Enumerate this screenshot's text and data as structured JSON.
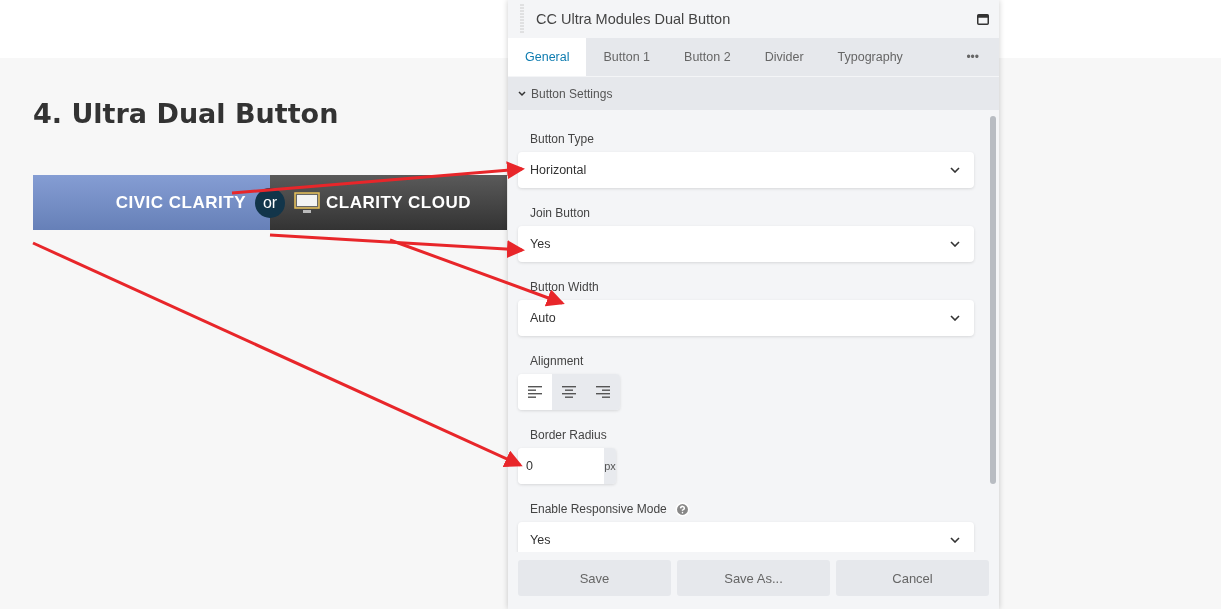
{
  "page": {
    "heading": "4. Ultra Dual Button",
    "dual_button": {
      "left_label": "CIVIC CLARITY",
      "divider": "or",
      "right_label": "CLARITY CLOUD"
    }
  },
  "panel": {
    "title": "CC Ultra Modules Dual Button",
    "tabs": [
      {
        "label": "General",
        "selected": true
      },
      {
        "label": "Button 1",
        "selected": false
      },
      {
        "label": "Button 2",
        "selected": false
      },
      {
        "label": "Divider",
        "selected": false
      },
      {
        "label": "Typography",
        "selected": false
      }
    ],
    "more": "•••",
    "section": {
      "label": "Button Settings",
      "expanded": true
    },
    "fields": [
      {
        "kind": "select",
        "label": "Button Type",
        "value": "Horizontal"
      },
      {
        "kind": "select",
        "label": "Join Button",
        "value": "Yes"
      },
      {
        "kind": "select",
        "label": "Button Width",
        "value": "Auto"
      },
      {
        "kind": "align",
        "label": "Alignment",
        "options": [
          {
            "kind": "left",
            "selected": true
          },
          {
            "kind": "center",
            "selected": false
          },
          {
            "kind": "right",
            "selected": false
          }
        ]
      },
      {
        "kind": "number",
        "label": "Border Radius",
        "value": "0",
        "unit": "px"
      },
      {
        "kind": "select",
        "label": "Enable Responsive Mode",
        "value": "Yes",
        "help": true
      }
    ],
    "buttons": [
      "Save",
      "Save As...",
      "Cancel"
    ]
  }
}
